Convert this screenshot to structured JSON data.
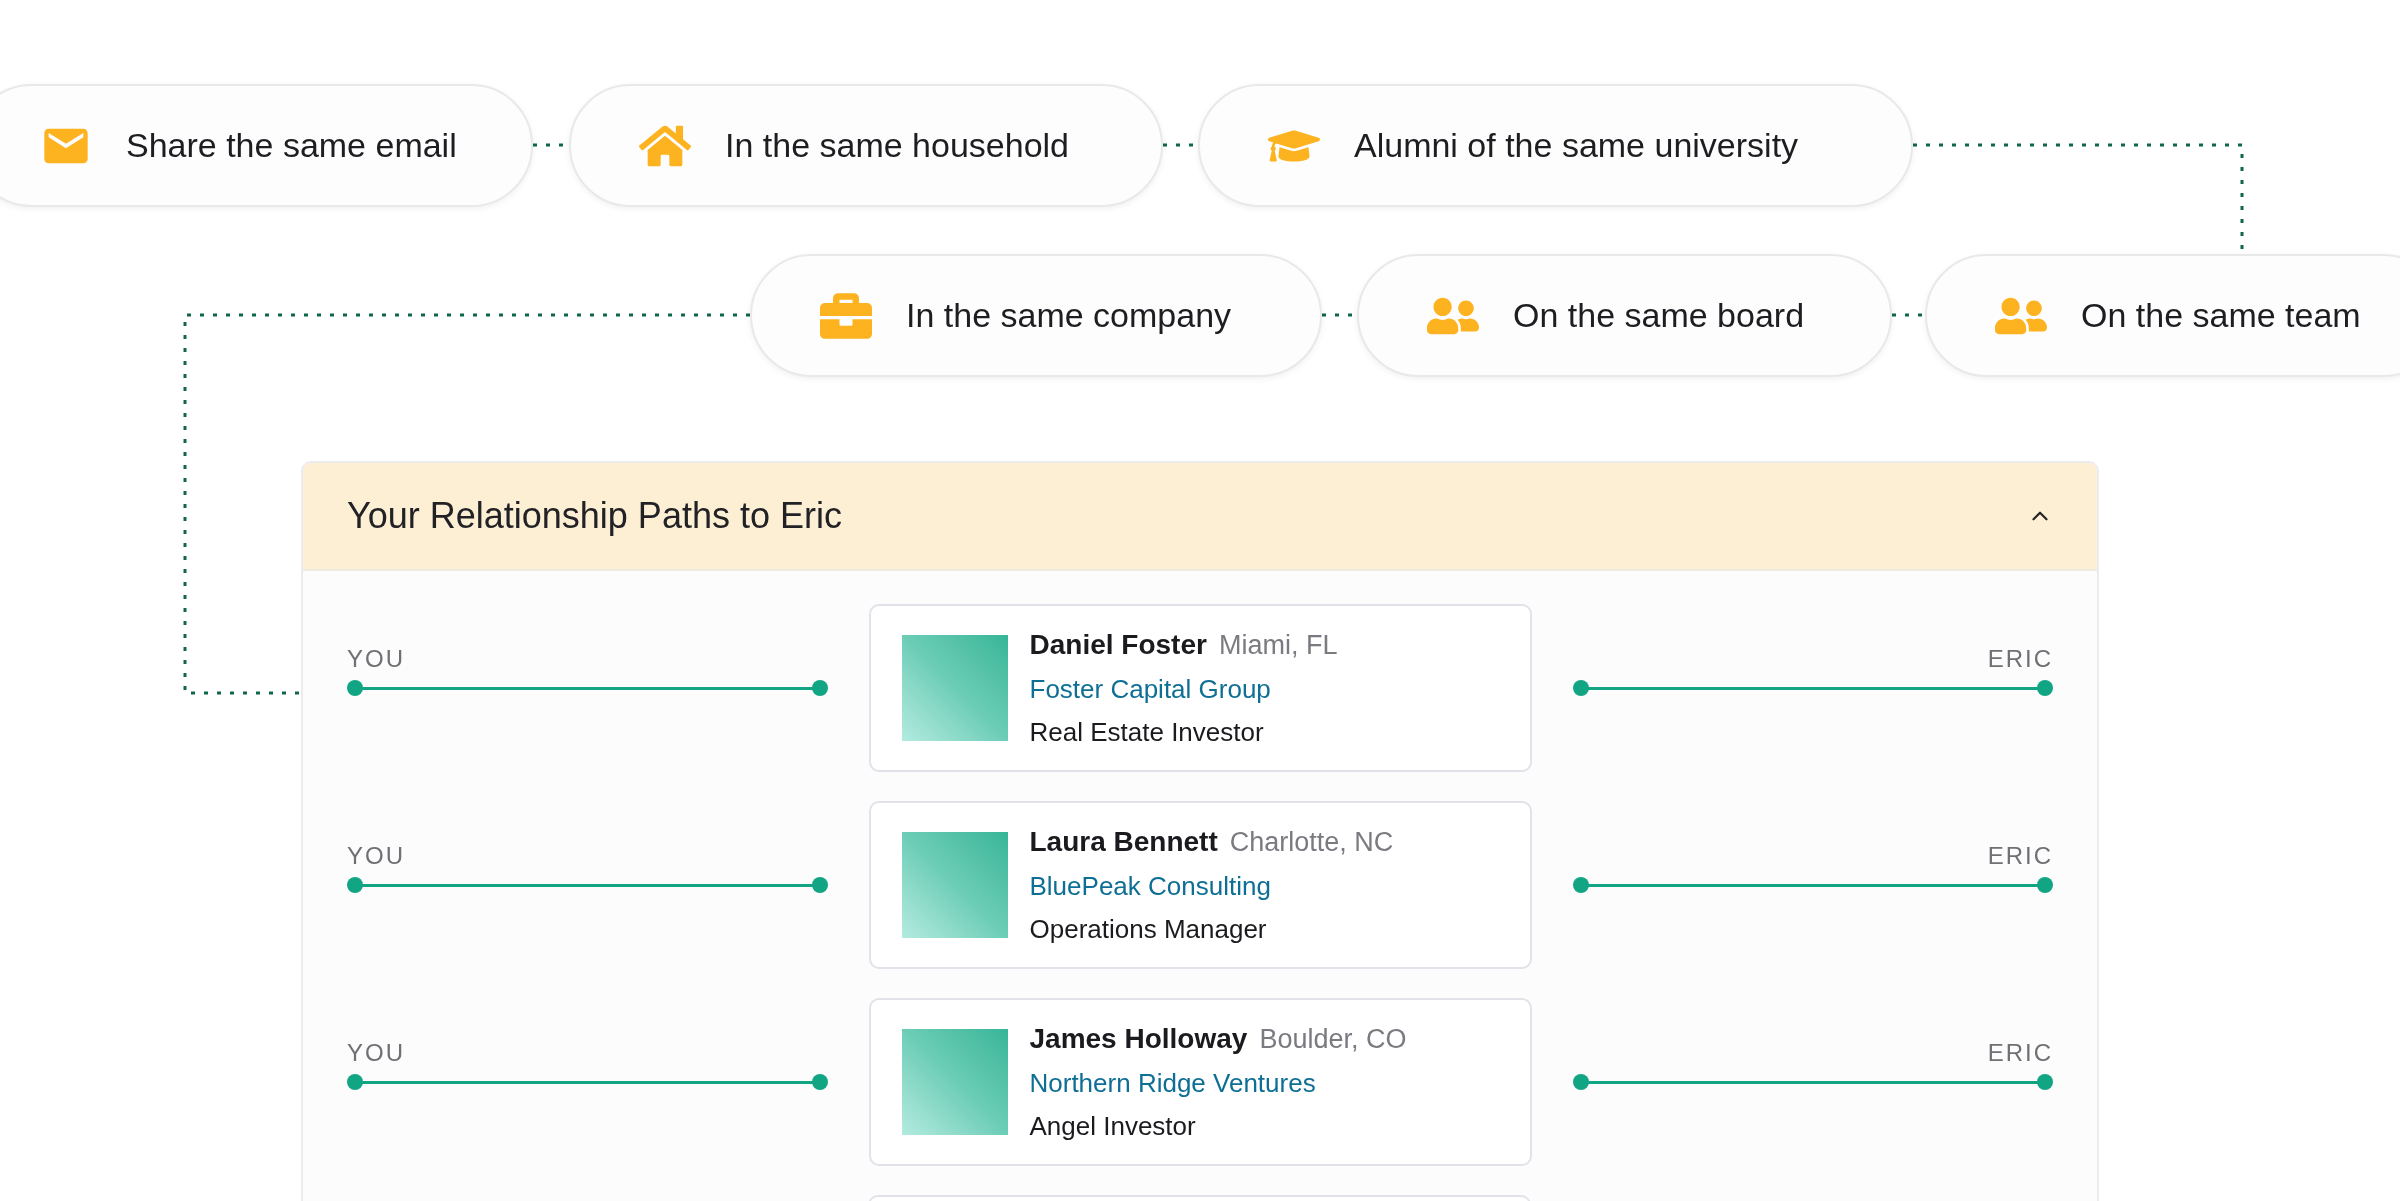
{
  "relationship_types": [
    {
      "label": "Share the same email"
    },
    {
      "label": "In the same household"
    },
    {
      "label": "Alumni of the same university"
    },
    {
      "label": "In the same company"
    },
    {
      "label": "On the same board"
    },
    {
      "label": "On the same team"
    }
  ],
  "panel": {
    "title": "Your Relationship Paths to Eric",
    "expanded": true,
    "more_paths": true,
    "paths": [
      {
        "start_label": "YOU",
        "end_label": "ERIC",
        "person": {
          "name": "Daniel Foster",
          "location": "Miami, FL",
          "company": "Foster Capital Group",
          "role": "Real Estate Investor"
        }
      },
      {
        "start_label": "YOU",
        "end_label": "ERIC",
        "person": {
          "name": "Laura Bennett",
          "location": "Charlotte, NC",
          "company": "BluePeak Consulting",
          "role": "Operations Manager"
        }
      },
      {
        "start_label": "YOU",
        "end_label": "ERIC",
        "person": {
          "name": "James Holloway",
          "location": "Boulder, CO",
          "company": "Northern Ridge Ventures",
          "role": "Angel Investor"
        }
      }
    ]
  }
}
